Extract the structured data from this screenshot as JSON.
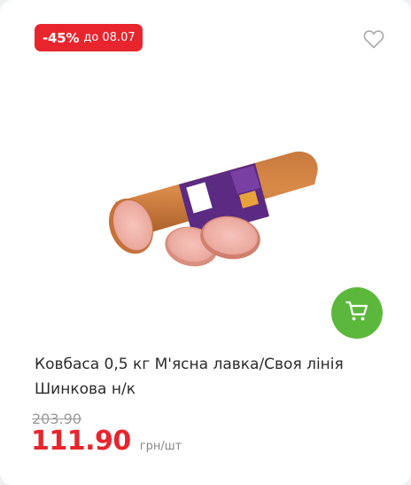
{
  "product": {
    "badge": {
      "discount": "-45%",
      "until": "до 08.07",
      "color": "#e8252d"
    },
    "image_subject": "sausage-shynkova",
    "wishlist_icon": "heart-outline-icon",
    "cart_icon": "cart-icon",
    "cart_color": "#5cb83c",
    "title": "Ковбаса 0,5 кг М'ясна лавка/Своя лінія Шинкова н/к",
    "old_price": "203.90",
    "price": "111.90",
    "unit": "грн/шт",
    "price_color": "#e8252d"
  }
}
